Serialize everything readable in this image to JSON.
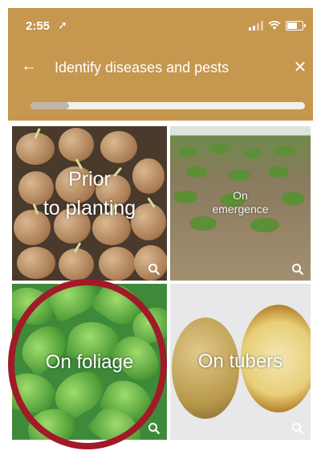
{
  "status_bar": {
    "time": "2:55",
    "location_glyph": "➚",
    "icons": [
      "signal-icon",
      "wifi-icon",
      "battery-icon"
    ]
  },
  "header": {
    "title": "Identify diseases and pests",
    "back_glyph": "←",
    "close_glyph": "✕",
    "background": "#c5974f"
  },
  "progress": {
    "fraction": 0.14
  },
  "tiles": [
    {
      "label_line1": "Prior",
      "label_line2": "to planting"
    },
    {
      "label_line1": "On",
      "label_line2": "emergence"
    },
    {
      "label": "On foliage"
    },
    {
      "label": "On tubers"
    }
  ],
  "highlight_color": "#a11a27"
}
